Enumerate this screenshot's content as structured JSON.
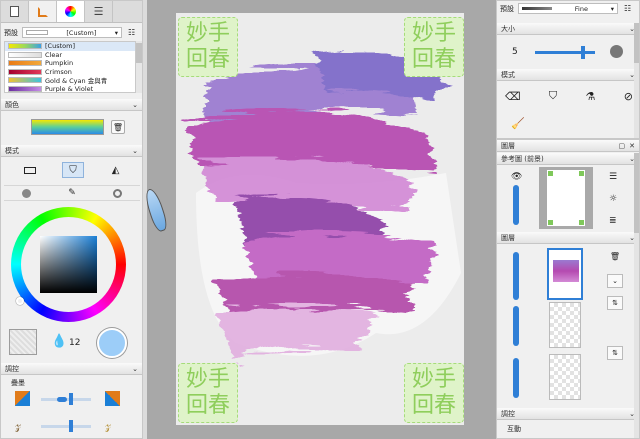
{
  "left": {
    "preset_label": "預設",
    "preset_value": "[Custom]",
    "gradients": [
      "[Custom]",
      "Clear",
      "Pumpkin",
      "Crimson",
      "Gold & Cyan 金與青",
      "Purple & Violet"
    ],
    "gradient_colors": [
      [
        "#f5e800",
        "#9ad95c",
        "#3aa0e6"
      ],
      [
        "#ffffff",
        "#dddddd"
      ],
      [
        "#e97b16",
        "#f2a93b"
      ],
      [
        "#a3002e",
        "#e23a59"
      ],
      [
        "#f1c232",
        "#3cc3e0"
      ],
      [
        "#6b2fa0",
        "#c48be6"
      ]
    ],
    "color_header": "顏色",
    "mode_header": "模式",
    "opacity_value": "12",
    "adjust_header": "調控",
    "stack_label": "疊墨"
  },
  "right": {
    "preset_label": "預設",
    "preset_value": "Fine",
    "size_header": "大小",
    "size_value": "5",
    "size_fraction": 0.8,
    "mode_header": "模式",
    "layers_title": "圖層",
    "reference_header": "參考圖 (前景)",
    "layers_header": "圖層",
    "adjust_header": "調控",
    "interact_label": "互動"
  },
  "canvas": {
    "watermark_line1": "妙手",
    "watermark_line2": "回春"
  },
  "colors": {
    "accent": "#2f7fd6",
    "watermark": "#9fd86e",
    "current_color": "#1a7fd6"
  }
}
